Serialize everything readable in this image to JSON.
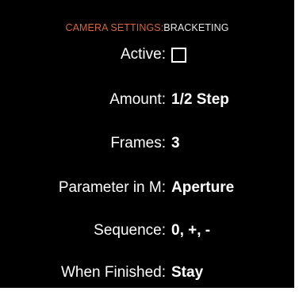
{
  "header": {
    "category": "CAMERA SETTINGS:",
    "section": "BRACKETING"
  },
  "settings": {
    "active": {
      "label": "Active:",
      "checked": false
    },
    "amount": {
      "label": "Amount:",
      "value": "1/2 Step"
    },
    "frames": {
      "label": "Frames:",
      "value": "3"
    },
    "parameter": {
      "label": "Parameter in M:",
      "value": "Aperture"
    },
    "sequence": {
      "label": "Sequence:",
      "value": "0, +, -"
    },
    "finished": {
      "label": "When Finished:",
      "value": "Stay"
    }
  },
  "colors": {
    "background": "#000000",
    "accent": "#d4663a",
    "text": "#ffffff"
  }
}
